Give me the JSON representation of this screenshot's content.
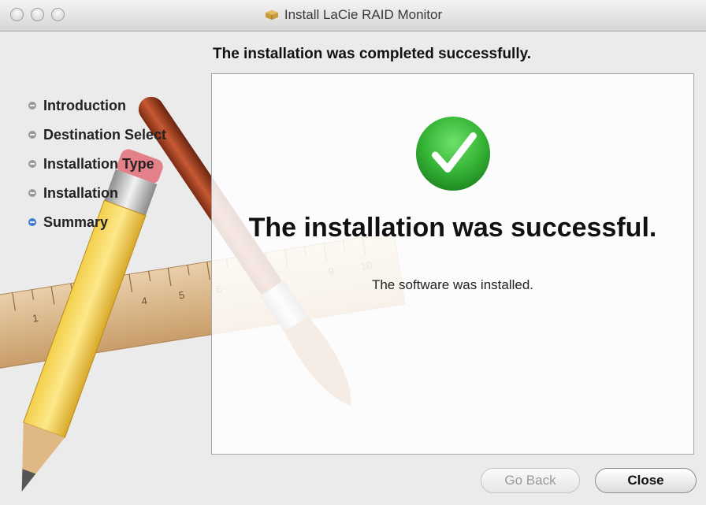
{
  "window": {
    "title": "Install LaCie RAID Monitor"
  },
  "heading": "The installation was completed successfully.",
  "steps": [
    {
      "label": "Introduction",
      "active": false
    },
    {
      "label": "Destination Select",
      "active": false
    },
    {
      "label": "Installation Type",
      "active": false
    },
    {
      "label": "Installation",
      "active": false
    },
    {
      "label": "Summary",
      "active": true
    }
  ],
  "panel": {
    "status_icon": "checkmark-icon",
    "title": "The installation was successful.",
    "message": "The software was installed."
  },
  "buttons": {
    "back_label": "Go Back",
    "close_label": "Close",
    "back_enabled": false
  },
  "ruler_ticks": [
    "1",
    "4",
    "5",
    "6",
    "9",
    "10"
  ],
  "colors": {
    "success_green": "#36b536",
    "active_step": "#3d7bd6"
  }
}
